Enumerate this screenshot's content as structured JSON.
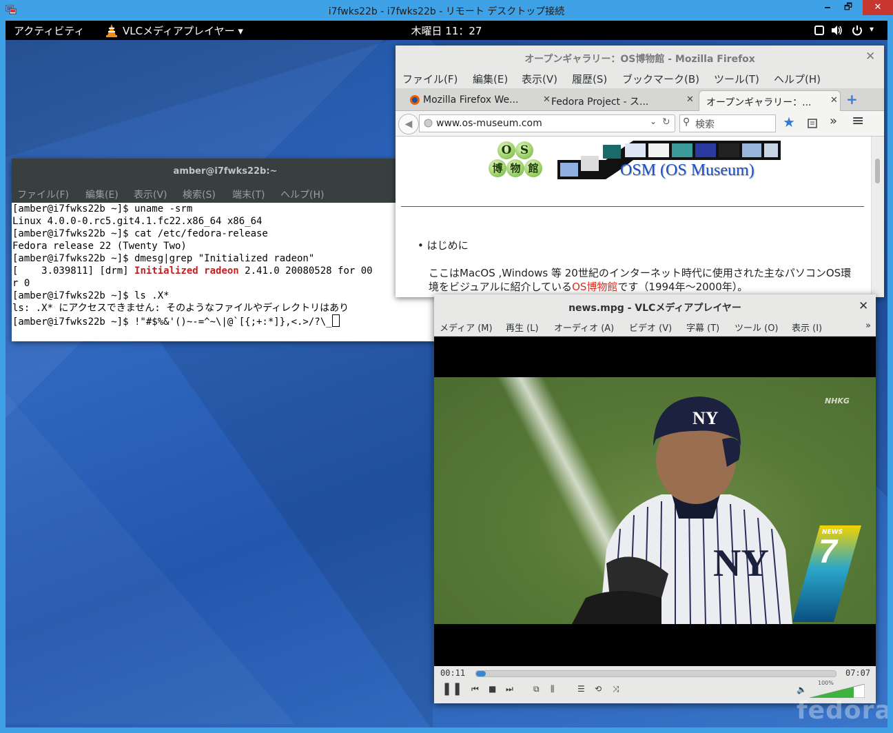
{
  "rdp": {
    "title": "i7fwks22b - i7fwks22b - リモート デスクトップ接続",
    "minimize": "🗕",
    "restore": "🗗",
    "close": "✕"
  },
  "topbar": {
    "activities": "アクティビティ",
    "app_menu": "VLCメディアプレイヤー ▾",
    "clock": "木曜日 11：27",
    "tray_icons": [
      "display-icon",
      "volume-icon",
      "power-icon"
    ]
  },
  "terminal": {
    "title": "amber@i7fwks22b:~",
    "menu": [
      "ファイル(F)",
      "編集(E)",
      "表示(V)",
      "検索(S)",
      "端末(T)",
      "ヘルプ(H)"
    ],
    "lines": [
      "[amber@i7fwks22b ~]$ uname -srm",
      "Linux 4.0.0-0.rc5.git4.1.fc22.x86_64 x86_64",
      "[amber@i7fwks22b ~]$ cat /etc/fedora-release",
      "Fedora release 22 (Twenty Two)",
      "[amber@i7fwks22b ~]$ dmesg|grep \"Initialized radeon\"",
      "r 0",
      "[amber@i7fwks22b ~]$ ls .X*",
      "ls: .X* にアクセスできません: そのようなファイルやディレクトリはあり",
      "[amber@i7fwks22b ~]$ !\"#$%&'()~-=^~\\|@`[{;+:*]},<.>/?\\_"
    ],
    "drm_prefix": "[    3.039811] [drm] ",
    "drm_highlight": "Initialized radeon",
    "drm_suffix": " 2.41.0 20080528 for 00"
  },
  "firefox": {
    "title": "オープンギャラリー：OS博物館 - Mozilla Firefox",
    "menu": [
      "ファイル(F)",
      "編集(E)",
      "表示(V)",
      "履歴(S)",
      "ブックマーク(B)",
      "ツール(T)",
      "ヘルプ(H)"
    ],
    "tabs": [
      {
        "label": "Mozilla Firefox We..."
      },
      {
        "label": "Fedora Project - ス..."
      },
      {
        "label": "オープンギャラリー：..."
      }
    ],
    "url": "www.os-museum.com",
    "search_placeholder": "検索",
    "page": {
      "logo_top": [
        "O",
        "S"
      ],
      "logo_bottom": [
        "博",
        "物",
        "館"
      ],
      "site_title": "OSM (OS Museum)",
      "bullet": "はじめに",
      "intro_line1": "ここはMacOS ,Windows 等 20世紀のインターネット時代に使用された主なパソコンOS環",
      "intro_line2_prefix": "境をビジュアルに紹介している",
      "intro_line2_link": "OS博物館",
      "intro_line2_suffix": "です（1994年〜2000年）。"
    }
  },
  "vlc": {
    "title": "news.mpg - VLCメディアプレイヤー",
    "menu": [
      "メディア (M)",
      "再生 (L)",
      "オーディオ (A)",
      "ビデオ (V)",
      "字幕 (T)",
      "ツール (O)",
      "表示 (I)"
    ],
    "elapsed": "00:11",
    "total": "07:07",
    "progress": 0.026,
    "volume_label": "100%",
    "volume": 1.0,
    "overlay_channel": "NHKG",
    "overlay_news": "NEWS",
    "overlay_number": "7"
  },
  "watermark": "fedora"
}
